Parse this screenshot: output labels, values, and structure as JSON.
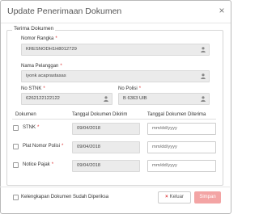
{
  "dialog": {
    "title": "Update Penerimaan Dokumen",
    "close_icon": "×"
  },
  "form": {
    "legend": "Terima Dokumen",
    "nomor_rangka": {
      "label": "Nomor Rangka",
      "required": "*",
      "value": "KRESNODH1H8012729"
    },
    "nama_pelanggan": {
      "label": "Nama Pelanggan",
      "required": "*",
      "value": "iyonk acaprastasas"
    },
    "no_stnk": {
      "label": "No STNK",
      "required": "*",
      "value": "6262122122122"
    },
    "no_polisi": {
      "label": "No Polisi",
      "required": "*",
      "value": "B 6363 UIB"
    }
  },
  "documents": {
    "headers": {
      "dokumen": "Dokumen",
      "tanggal_dikirim": "Tanggal Dokumen Dikirim",
      "tanggal_diterima": "Tanggal Dokumen Diterima"
    },
    "rows": [
      {
        "label": "STNK",
        "required": "*",
        "sent": "09/04/2018",
        "received_placeholder": "mm/dd/yyyy"
      },
      {
        "label": "Plat Nomor Polisi",
        "required": "*",
        "sent": "09/04/2018",
        "received_placeholder": "mm/dd/yyyy"
      },
      {
        "label": "Notice Pajak",
        "required": "*",
        "sent": "09/04/2018",
        "received_placeholder": "mm/dd/yyyy"
      }
    ]
  },
  "footer": {
    "checkbox_label": "Kelengkapan Dokumen Sudah Diperiksa",
    "cancel_icon": "×",
    "cancel_label": "Keluar",
    "save_label": "Simpan"
  },
  "colors": {
    "required": "#dd3333",
    "readonly_bg": "#ebebeb",
    "save_button_bg": "#f3a4a4"
  }
}
